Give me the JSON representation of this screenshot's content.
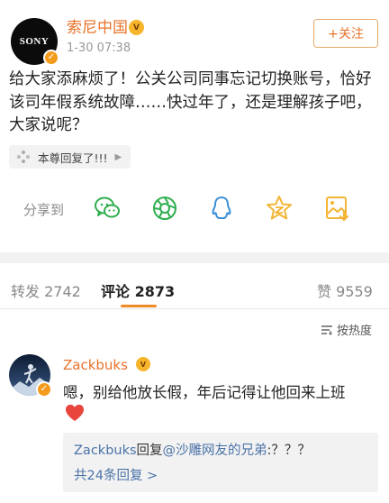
{
  "post": {
    "author": "索尼中国",
    "avatar_text": "SONY",
    "time": "1-30 07:38",
    "follow_label": "+关注",
    "text": "给大家添麻烦了！公关公司同事忘记切换账号，恰好该司年假系统故障……快过年了，还是理解孩子吧，大家说呢？",
    "reply_pill": "本尊回复了!!!"
  },
  "share": {
    "label": "分享到",
    "icons": [
      "wechat-icon",
      "moments-icon",
      "qq-icon",
      "qzone-icon",
      "save-image-icon"
    ]
  },
  "tabs": {
    "repost_label": "转发",
    "repost_count": "2742",
    "comment_label": "评论",
    "comment_count": "2873",
    "like_label": "赞",
    "like_count": "9559"
  },
  "sort_label": "按热度",
  "comment": {
    "user": "Zackbuks",
    "text": "嗯，别给他放长假，年后记得让他回来上班",
    "reply": {
      "user": "Zackbuks",
      "verb": "回复",
      "target": "@沙雕网友的兄弟",
      "content": ":？？？",
      "more": "共24条回复 >"
    }
  },
  "colors": {
    "accent": "#e8722a",
    "link": "#4a73a8",
    "icon_green": "#2fae4e",
    "icon_blue": "#3a8fd8",
    "icon_gold": "#f2b534"
  }
}
